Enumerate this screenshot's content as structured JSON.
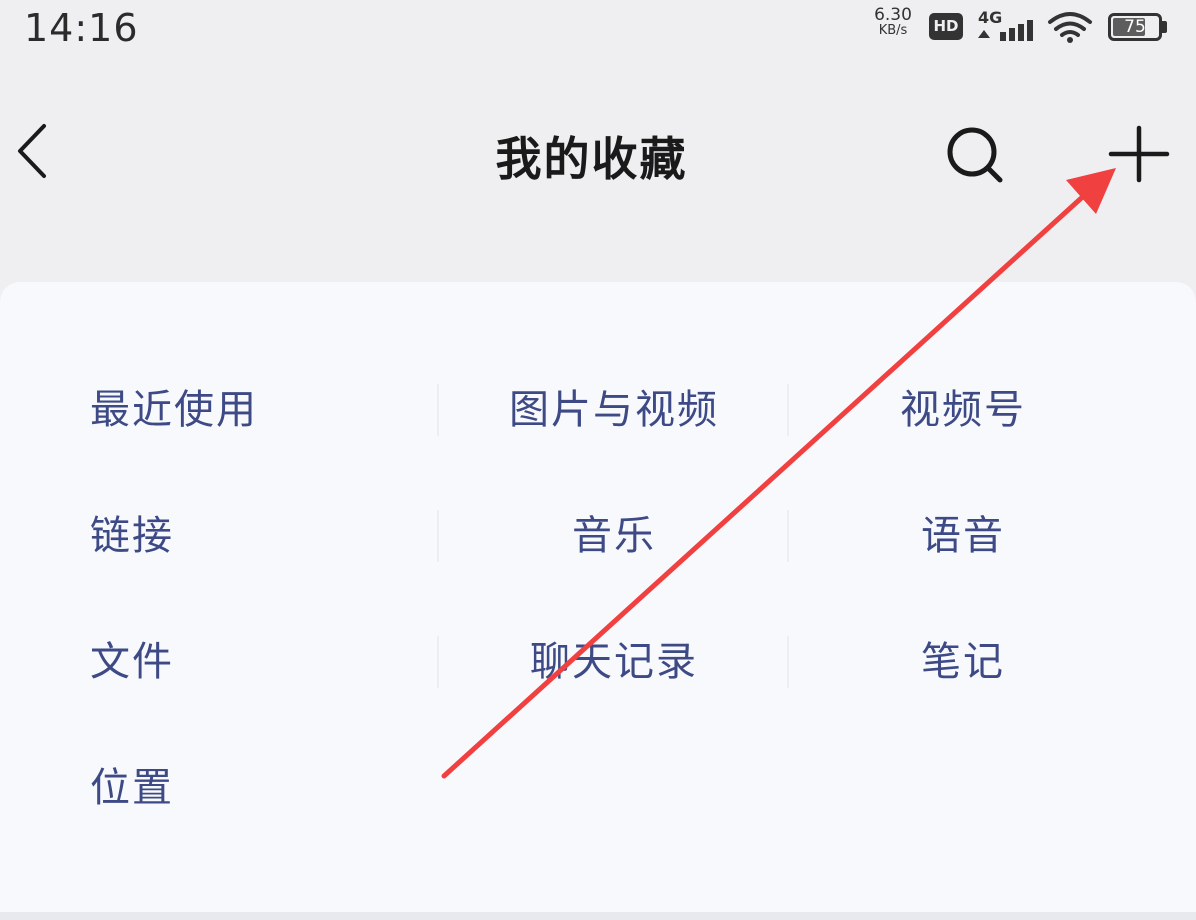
{
  "status_bar": {
    "time": "14:16",
    "net_speed_value": "6.30",
    "net_speed_unit": "KB/s",
    "hd_label": "HD",
    "network_label": "4G",
    "battery_level": "75",
    "battery_fraction": 0.75
  },
  "header": {
    "title": "我的收藏"
  },
  "filters": {
    "recent": "最近使用",
    "photos_videos": "图片与视频",
    "channels": "视频号",
    "links": "链接",
    "music": "音乐",
    "voice": "语音",
    "files": "文件",
    "chat_history": "聊天记录",
    "notes": "笔记",
    "location": "位置"
  },
  "colors": {
    "accent_text": "#3d4a85",
    "annotation_arrow": "#f04040",
    "background": "#efeff1",
    "card": "#f8f9fd"
  },
  "icons": [
    "back-icon",
    "search-icon",
    "plus-icon",
    "hd-icon",
    "signal-icon",
    "wifi-icon",
    "battery-icon"
  ]
}
